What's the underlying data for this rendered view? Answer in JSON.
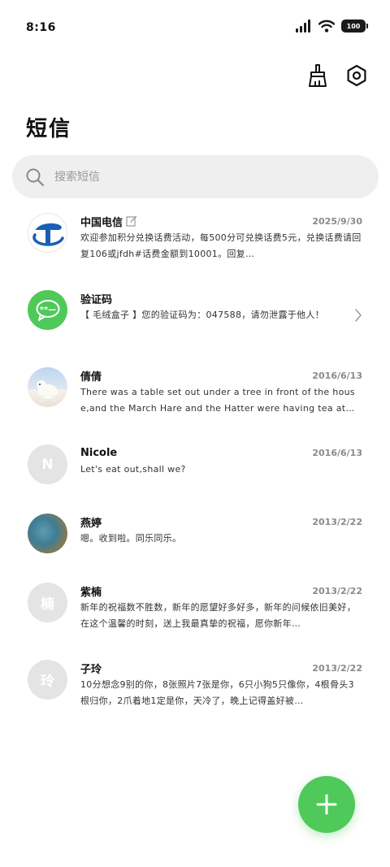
{
  "status": {
    "time": "8:16",
    "battery": "100"
  },
  "header": {
    "title": "短信"
  },
  "search": {
    "placeholder": "搜索短信"
  },
  "messages": [
    {
      "name": "中国电信",
      "date": "2025/9/30",
      "preview": "欢迎参加积分兑换话费活动，每500分可兑换话费5元，兑换话费请回复106或jfdh#话费金额到10001。回复…"
    },
    {
      "name": "验证码",
      "date": "",
      "preview": "【 毛绒盒子 】您的验证码为：047588，请勿泄露于他人！"
    },
    {
      "name": "倩倩",
      "date": "2016/6/13",
      "preview": "There was a table set out under a tree in front of the house,and the March Hare and the Hatter were having tea at…"
    },
    {
      "name": "Nicole",
      "date": "2016/6/13",
      "preview": "Let's eat out,shall we?",
      "avatar_letter": "N"
    },
    {
      "name": "燕婷",
      "date": "2013/2/22",
      "preview": "嗯。收到啦。同乐同乐。"
    },
    {
      "name": "紫楠",
      "date": "2013/2/22",
      "preview": "新年的祝福数不胜数，新年的愿望好多好多，新年的问候依旧美好，在这个温馨的时刻，送上我最真挚的祝福，愿你新年…",
      "avatar_letter": "楠"
    },
    {
      "name": "子玲",
      "date": "2013/2/22",
      "preview": "10分想念9别的你，8张照片7张是你，6只小狗5只像你，4根骨头3根归你，2爪着地1定是你，天冷了，晚上记得盖好被…",
      "avatar_letter": "玲"
    }
  ],
  "colors": {
    "accent": "#4fc95a",
    "telecom_blue": "#1a5fb4",
    "search_bg": "#efefef"
  },
  "icons": {
    "clean": "broom-icon",
    "settings": "hexagon-gear-icon",
    "search": "search-icon",
    "compose": "plus-icon"
  }
}
